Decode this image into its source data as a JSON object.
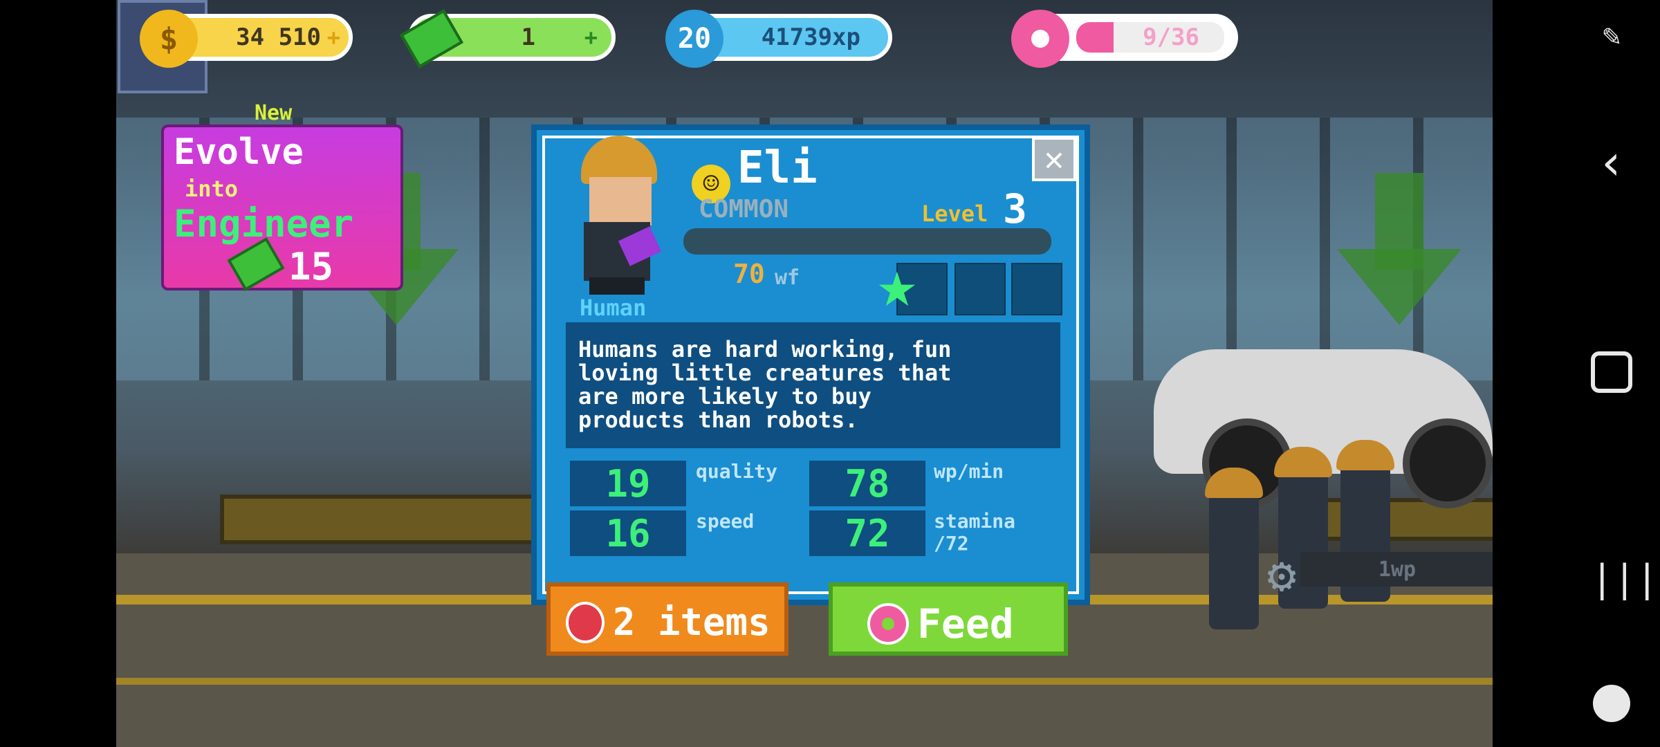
{
  "hud": {
    "coins": "34 510",
    "cash": "1",
    "player_level": "20",
    "xp": "41739xp",
    "donuts": "9/36",
    "coin_icon": "$"
  },
  "evolve": {
    "new_tag": "New",
    "line1": "Evolve",
    "line2": "into",
    "line3": "Engineer",
    "cost": "15"
  },
  "character": {
    "name": "Eli",
    "rarity": "COMMON",
    "level_label": "Level",
    "level": "3",
    "race": "Human",
    "wf_value": "70",
    "wf_unit": "wf",
    "description": "Humans are hard working, fun\nloving little creatures that\nare more likely to buy\nproducts than robots.",
    "stars_earned": 1,
    "stars_total": 3,
    "xp_progress": 0.0
  },
  "stats": {
    "quality_value": "19",
    "quality_label": "quality",
    "speed_value": "16",
    "speed_label": "speed",
    "wp_value": "78",
    "wp_label": "wp/min",
    "stamina_value": "72",
    "stamina_label": "stamina\n/72"
  },
  "buttons": {
    "items_label": "2 items",
    "feed_label": "Feed",
    "close_glyph": "✕"
  },
  "background": {
    "wp_text": "1wp"
  },
  "colors": {
    "dialog": "#1a8ed0",
    "stat_green": "#3cf07a",
    "items_orange": "#f08a1c",
    "feed_green": "#7ed83a",
    "evolve_magenta": "#d43ac8"
  }
}
